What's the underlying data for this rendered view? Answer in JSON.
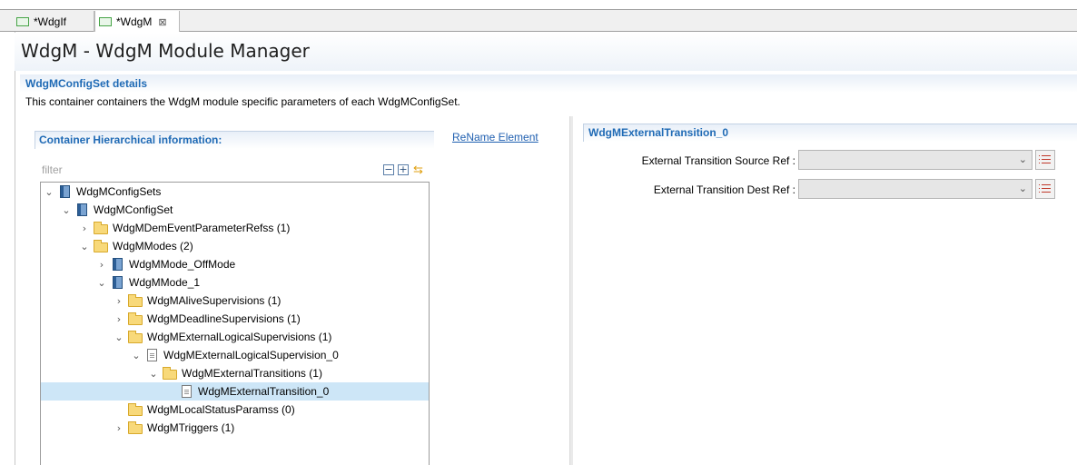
{
  "tabs": [
    {
      "label": "*WdgIf",
      "active": false
    },
    {
      "label": "*WdgM",
      "active": true,
      "close": "⊠"
    }
  ],
  "page_title": "WdgM - WdgM Module Manager",
  "section": {
    "title": "WdgMConfigSet details",
    "description": "This container containers the WdgM module specific parameters of each WdgMConfigSet."
  },
  "hierarchy": {
    "title": "Container Hierarchical information:",
    "rename_link": "ReName Element",
    "filter_placeholder": "filter",
    "tree": [
      {
        "label": "WdgMConfigSets",
        "icon": "module-icon",
        "twisty": "expanded"
      },
      {
        "label": "WdgMConfigSet",
        "icon": "module-icon",
        "twisty": "expanded"
      },
      {
        "label": "WdgMDemEventParameterRefss (1)",
        "icon": "folder-icon",
        "twisty": "collapsed"
      },
      {
        "label": "WdgMModes (2)",
        "icon": "folder-icon",
        "twisty": "expanded"
      },
      {
        "label": "WdgMMode_OffMode",
        "icon": "module-icon",
        "twisty": "collapsed"
      },
      {
        "label": "WdgMMode_1",
        "icon": "module-icon",
        "twisty": "expanded"
      },
      {
        "label": "WdgMAliveSupervisions (1)",
        "icon": "folder-icon",
        "twisty": "collapsed"
      },
      {
        "label": "WdgMDeadlineSupervisions (1)",
        "icon": "folder-icon",
        "twisty": "collapsed"
      },
      {
        "label": "WdgMExternalLogicalSupervisions (1)",
        "icon": "folder-icon",
        "twisty": "expanded"
      },
      {
        "label": "WdgMExternalLogicalSupervision_0",
        "icon": "document-icon",
        "twisty": "expanded"
      },
      {
        "label": "WdgMExternalTransitions (1)",
        "icon": "folder-icon",
        "twisty": "expanded"
      },
      {
        "label": "WdgMExternalTransition_0",
        "icon": "document-icon",
        "twisty": "none",
        "selected": true
      },
      {
        "label": "WdgMLocalStatusParamss (0)",
        "icon": "folder-icon",
        "twisty": "none"
      },
      {
        "label": "WdgMTriggers (1)",
        "icon": "folder-icon",
        "twisty": "collapsed"
      }
    ]
  },
  "details": {
    "title": "WdgMExternalTransition_0",
    "fields": [
      {
        "label": "External Transition Source Ref :",
        "value": ""
      },
      {
        "label": "External Transition Dest Ref :",
        "value": ""
      }
    ]
  },
  "colors": {
    "section_title": "#1f6ab5",
    "selection": "#cde6f7",
    "link": "#1f5fb0"
  }
}
